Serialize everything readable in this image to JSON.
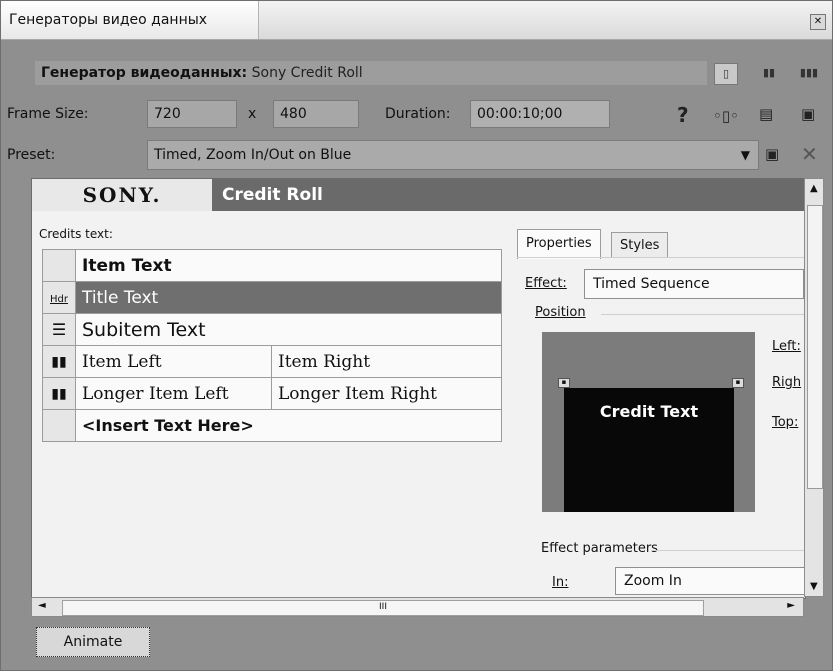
{
  "window": {
    "title": "Генераторы видео данных",
    "close_icon": "close-icon"
  },
  "generator": {
    "label": "Генератор видеоданных:",
    "name": "Sony Credit Roll"
  },
  "frame": {
    "label": "Frame Size:",
    "width": "720",
    "sep": "x",
    "height": "480",
    "duration_label": "Duration:",
    "duration": "00:00:10;00"
  },
  "preset": {
    "label": "Preset:",
    "value": "Timed, Zoom In/Out on Blue"
  },
  "plugin": {
    "brand": "SONY.",
    "title": "Credit Roll"
  },
  "credits": {
    "label": "Credits text:",
    "header": "Item Text",
    "rows": [
      {
        "icon": "Hdr",
        "left": "Title Text",
        "right": ""
      },
      {
        "icon": "subitem-icon",
        "left": "Subitem Text",
        "right": ""
      },
      {
        "icon": "two-column-icon",
        "left": "Item Left",
        "right": "Item Right"
      },
      {
        "icon": "two-column-icon",
        "left": "Longer Item Left",
        "right": "Longer Item Right"
      },
      {
        "icon": "",
        "left": "<Insert Text Here>",
        "right": ""
      }
    ]
  },
  "properties": {
    "tabs": [
      "Properties",
      "Styles"
    ],
    "effect_label": "Effect:",
    "effect_value": "Timed Sequence",
    "position_label": "Position",
    "preview_text": "Credit Text",
    "left_label": "Left:",
    "right_label": "Righ",
    "top_label": "Top:",
    "effect_params_label": "Effect parameters",
    "in_label": "In:",
    "in_value": "Zoom In"
  },
  "hscroll_label": "III",
  "animate_label": "Animate"
}
